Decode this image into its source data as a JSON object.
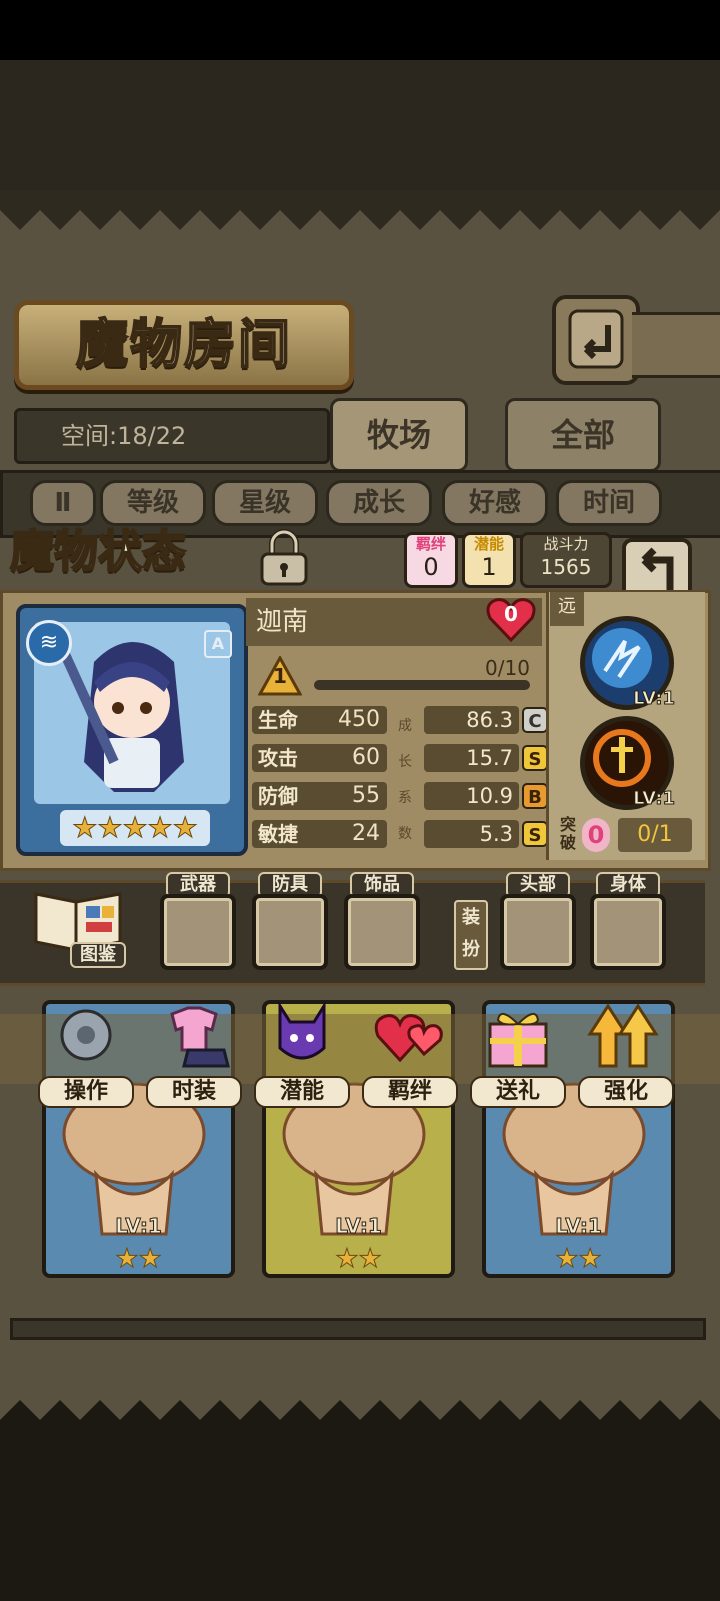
{
  "header": {
    "title": "魔物房间",
    "back_icon": "return-icon"
  },
  "room": {
    "space_text": "空间:18/22",
    "tabs": [
      "牧场",
      "全部"
    ],
    "active_tab": 0
  },
  "sort": {
    "toggle_label": "Ⅱ",
    "buttons": [
      "等级",
      "星级",
      "成长",
      "好感",
      "时间"
    ]
  },
  "status": {
    "title": "魔物状态",
    "bond_label": "羁绊",
    "bond_value": "0",
    "potential_label": "潜能",
    "potential_value": "1",
    "power_label": "战斗力",
    "power_value": "1565",
    "monster_name": "迦南",
    "favor": "0",
    "class_badge": "A",
    "stars": 5,
    "rank": "1",
    "exp_text": "0/10",
    "exp_fraction": 0,
    "growth_vertical": "成长系数",
    "stats": [
      {
        "label": "生命",
        "value": "450",
        "growth": "86.3",
        "grade": "C"
      },
      {
        "label": "攻击",
        "value": "60",
        "growth": "15.7",
        "grade": "S"
      },
      {
        "label": "防御",
        "value": "55",
        "growth": "10.9",
        "grade": "B"
      },
      {
        "label": "敏捷",
        "value": "24",
        "growth": "5.3",
        "grade": "S"
      }
    ],
    "range_tag": "远",
    "skills": [
      {
        "level": "LV:1"
      },
      {
        "level": "LV:1"
      }
    ],
    "breakthrough_label": "突破",
    "breakthrough_value": "0",
    "breakthrough_progress": "0/1"
  },
  "equipment": {
    "book_label": "图鉴",
    "equip_label": "装扮",
    "slots_left": [
      "武器",
      "防具",
      "饰品"
    ],
    "slots_right": [
      "头部",
      "身体"
    ]
  },
  "actions": [
    "操作",
    "时装",
    "潜能",
    "羁绊",
    "送礼",
    "强化"
  ],
  "cards": [
    {
      "level": "LV:1",
      "stars": 2
    },
    {
      "level": "LV:1",
      "stars": 2
    },
    {
      "level": "LV:1",
      "stars": 2
    }
  ],
  "colors": {
    "gold": "#e8b23a",
    "pink": "#e2407a",
    "parchment": "#a08c64"
  }
}
